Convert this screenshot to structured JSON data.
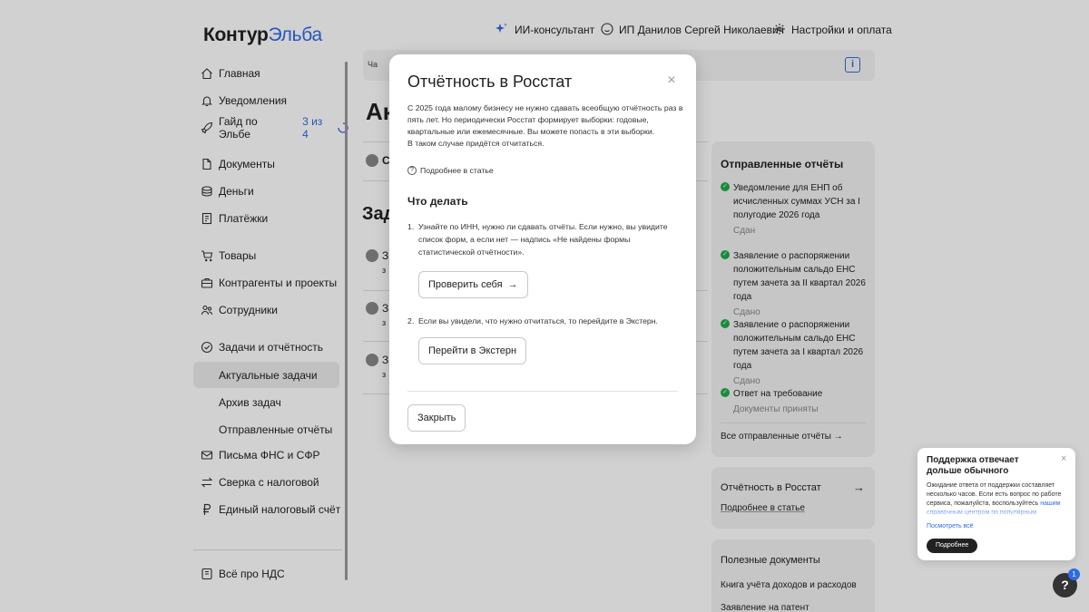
{
  "logo": {
    "brand": "Контур",
    "product": "Эльба"
  },
  "topbar": {
    "ai": "ИИ-консультант",
    "user": "ИП Данилов Сергей Николаевич",
    "settings": "Настройки и оплата"
  },
  "sidebar": {
    "home": "Главная",
    "notifications": "Уведомления",
    "guide": "Гайд по Эльбе",
    "guide_progress": "3 из 4",
    "documents": "Документы",
    "money": "Деньги",
    "payments": "Платёжки",
    "goods": "Товары",
    "contractors": "Контрагенты и проекты",
    "employees": "Сотрудники",
    "tasks": "Задачи и отчётность",
    "tasks_current": "Актуальные задачи",
    "tasks_archive": "Архив задач",
    "tasks_sent": "Отправленные отчёты",
    "letters": "Письма ФНС и СФР",
    "reconciliation": "Сверка с налоговой",
    "ens": "Единый налоговый счёт",
    "vat": "Всё про НДС"
  },
  "main": {
    "crumb": "Ча",
    "info_icon": "i",
    "title_visible": "Ак",
    "row_c": "С",
    "section_visible": "Зад",
    "row_letter": "З",
    "row_sub": "з"
  },
  "sent_reports": {
    "title": "Отправленные отчёты",
    "items": [
      {
        "text": "Уведомление для ЕНП об исчисленных суммах УСН за I полугодие 2026 года",
        "status": "Сдан"
      },
      {
        "text": "Заявление о распоряжении положительным сальдо ЕНС путем зачета за II квартал 2026 года",
        "status": "Сдано"
      },
      {
        "text": "Заявление о распоряжении положительным сальдо ЕНС путем зачета за I квартал 2026 года",
        "status": "Сдано"
      },
      {
        "text": "Ответ на требование",
        "status": "Документы приняты"
      }
    ],
    "all_link": "Все отправленные отчёты",
    "all_arrow": "→"
  },
  "rosstat_card": {
    "title": "Отчётность в Росстат",
    "arrow": "→",
    "link": "Подробнее в статье"
  },
  "useful_docs": {
    "title": "Полезные документы",
    "items": [
      "Книга учёта доходов и расходов",
      "Заявление на патент"
    ]
  },
  "modal": {
    "title": "Отчётность в Росстат",
    "close": "×",
    "paragraph": "С 2025 года малому бизнесу не нужно сдавать всеобщую отчётность раз в пять лет. Но периодически Росстат формирует выборки: годовые, квартальные или ежемесячные. Вы можете попасть в эти выборки.",
    "paragraph2": "В таком случае придётся отчитаться.",
    "more_link": "Подробнее в статье",
    "more_icon": "?",
    "what_to_do": "Что делать",
    "step1_num": "1.",
    "step1": "Узнайте по ИНН, нужно ли сдавать отчёты. Если нужно, вы увидите список форм, а если нет — надпись «Не найдены формы статистической отчётности».",
    "check_button": "Проверить себя",
    "check_arrow": "→",
    "step2_num": "2.",
    "step2": "Если вы увидели, что нужно отчитаться, то перейдите в Экстерн.",
    "extern_button": "Перейти в Экстерн",
    "close_button": "Закрыть"
  },
  "support": {
    "title": "Поддержка отвечает дольше обычного",
    "close": "×",
    "text": "Ожидание ответа от поддержки составляет несколько часов. Если есть вопрос по работе сервиса, пожалуйста, воспользуйтесь ",
    "text_link": "нашим справочным центром по популярным",
    "see_all": "Посмотреть всё",
    "button": "Подробнее"
  },
  "help": {
    "label": "?",
    "badge": "1"
  },
  "colors": {
    "accent": "#2e6be6",
    "success": "#1faa4b",
    "dark": "#222222"
  }
}
